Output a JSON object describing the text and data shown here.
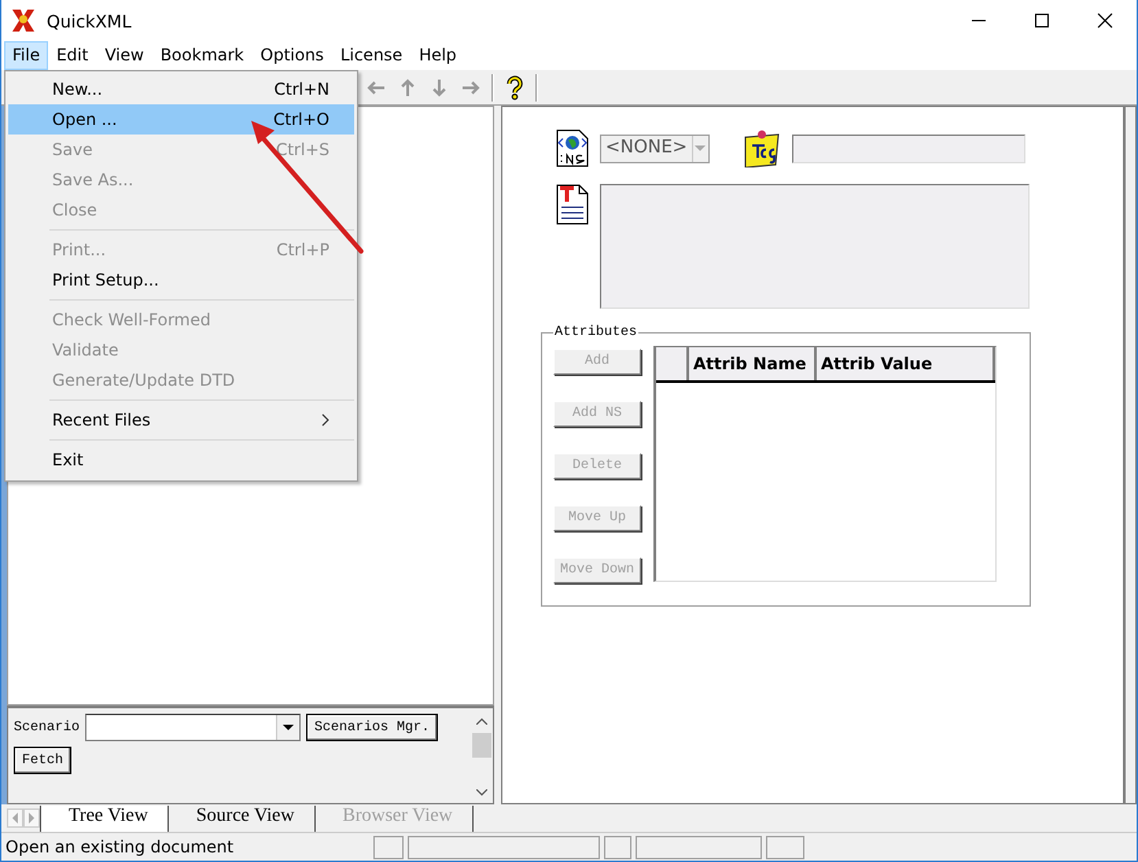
{
  "window": {
    "title": "QuickXML"
  },
  "menu_bar": [
    {
      "label": "File",
      "selected": true
    },
    {
      "label": "Edit",
      "selected": false
    },
    {
      "label": "View",
      "selected": false
    },
    {
      "label": "Bookmark",
      "selected": false
    },
    {
      "label": "Options",
      "selected": false
    },
    {
      "label": "License",
      "selected": false
    },
    {
      "label": "Help",
      "selected": false
    }
  ],
  "file_menu": [
    {
      "kind": "item",
      "label": "New...",
      "shortcut": "Ctrl+N",
      "disabled": false,
      "selected": false
    },
    {
      "kind": "item",
      "label": "Open ...",
      "shortcut": "Ctrl+O",
      "disabled": false,
      "selected": true
    },
    {
      "kind": "item",
      "label": "Save",
      "shortcut": "Ctrl+S",
      "disabled": true,
      "selected": false
    },
    {
      "kind": "item",
      "label": "Save As...",
      "disabled": true,
      "selected": false
    },
    {
      "kind": "item",
      "label": "Close",
      "disabled": true,
      "selected": false
    },
    {
      "kind": "separator"
    },
    {
      "kind": "item",
      "label": "Print...",
      "shortcut": "Ctrl+P",
      "disabled": true,
      "selected": false
    },
    {
      "kind": "item",
      "label": "Print Setup...",
      "disabled": false,
      "selected": false
    },
    {
      "kind": "separator"
    },
    {
      "kind": "item",
      "label": "Check Well-Formed",
      "disabled": true,
      "selected": false
    },
    {
      "kind": "item",
      "label": "Validate",
      "disabled": true,
      "selected": false
    },
    {
      "kind": "item",
      "label": "Generate/Update DTD",
      "disabled": true,
      "selected": false
    },
    {
      "kind": "separator"
    },
    {
      "kind": "submenu",
      "label": "Recent Files",
      "disabled": false,
      "selected": false
    },
    {
      "kind": "separator"
    },
    {
      "kind": "item",
      "label": "Exit",
      "disabled": false,
      "selected": false
    }
  ],
  "element_editor": {
    "namespace": {
      "value": "<NONE>"
    }
  },
  "attributes": {
    "title": "Attributes",
    "buttons": [
      {
        "label": "Add",
        "disabled": true
      },
      {
        "label": "Add NS",
        "disabled": true
      },
      {
        "label": "Delete",
        "disabled": true
      },
      {
        "label": "Move Up",
        "disabled": true
      },
      {
        "label": "Move Down",
        "disabled": true
      }
    ],
    "table": {
      "columns": [
        "Attrib Name",
        "Attrib Value"
      ]
    }
  },
  "scenario": {
    "label": "Scenario",
    "buttons": [
      "Scenarios Mgr.",
      "Fetch"
    ]
  },
  "view_tabs": [
    {
      "label": "Tree View",
      "selected": true,
      "disabled": false
    },
    {
      "label": "Source View",
      "selected": false,
      "disabled": false
    },
    {
      "label": "Browser View",
      "selected": false,
      "disabled": true
    }
  ],
  "status_bar": {
    "text": "Open an existing document"
  }
}
